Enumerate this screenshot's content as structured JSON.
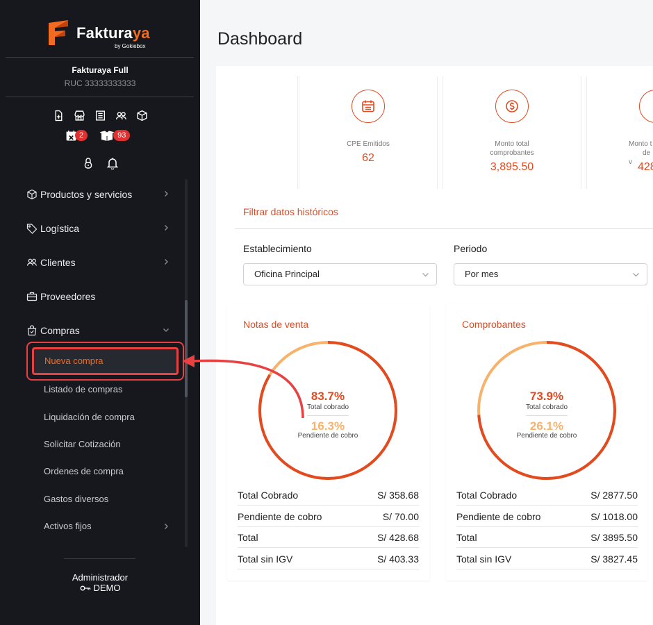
{
  "brand": {
    "name_part1": "Faktura",
    "name_part2": "ya",
    "sub": "by Gokiebox"
  },
  "company": {
    "name": "Fakturaya Full",
    "ruc": "RUC 33333333333"
  },
  "badges": {
    "calendar": "2",
    "box": "93"
  },
  "menu": {
    "productos": "Productos y servicios",
    "logistica": "Logística",
    "clientes": "Clientes",
    "proveedores": "Proveedores",
    "compras": "Compras",
    "sub": {
      "nueva": "Nueva compra",
      "listado": "Listado de compras",
      "liquidacion": "Liquidación de compra",
      "cotizacion": "Solicitar Cotización",
      "ordenes": "Ordenes de compra",
      "gastos": "Gastos diversos",
      "activos": "Activos fijos"
    }
  },
  "user": {
    "role": "Administrador",
    "name": "DEMO"
  },
  "page": {
    "title": "Dashboard"
  },
  "stats": {
    "cpe_label": "CPE Emitidos",
    "cpe_value": "62",
    "monto_label1": "Monto total",
    "monto_label2": "comprobantes",
    "monto_value": "3,895.50",
    "partial_label1": "Monto t",
    "partial_label2": "de v",
    "partial_value": "428"
  },
  "filter": {
    "title": "Filtrar datos históricos",
    "establecimiento_label": "Establecimiento",
    "establecimiento_value": "Oficina Principal",
    "periodo_label": "Periodo",
    "periodo_value": "Por mes"
  },
  "notas": {
    "title": "Notas de venta",
    "cobrado_pct": "83.7%",
    "cobrado_label": "Total cobrado",
    "pendiente_pct": "16.3%",
    "pendiente_label": "Pendiente de cobro",
    "cobrado_fraction": 0.837,
    "rows": [
      {
        "label": "Total Cobrado",
        "value": "S/ 358.68"
      },
      {
        "label": "Pendiente de cobro",
        "value": "S/ 70.00"
      },
      {
        "label": "Total",
        "value": "S/ 428.68"
      },
      {
        "label": "Total sin IGV",
        "value": "S/ 403.33"
      }
    ]
  },
  "comprobantes": {
    "title": "Comprobantes",
    "cobrado_pct": "73.9%",
    "cobrado_label": "Total cobrado",
    "pendiente_pct": "26.1%",
    "pendiente_label": "Pendiente de cobro",
    "cobrado_fraction": 0.739,
    "rows": [
      {
        "label": "Total Cobrado",
        "value": "S/ 2877.50"
      },
      {
        "label": "Pendiente de cobro",
        "value": "S/ 1018.00"
      },
      {
        "label": "Total",
        "value": "S/ 3895.50"
      },
      {
        "label": "Total sin IGV",
        "value": "S/ 3827.45"
      }
    ]
  },
  "colors": {
    "accent": "#e24a20",
    "pending": "#f7b26c",
    "sidebar": "#16181d",
    "highlight": "#e84141"
  }
}
